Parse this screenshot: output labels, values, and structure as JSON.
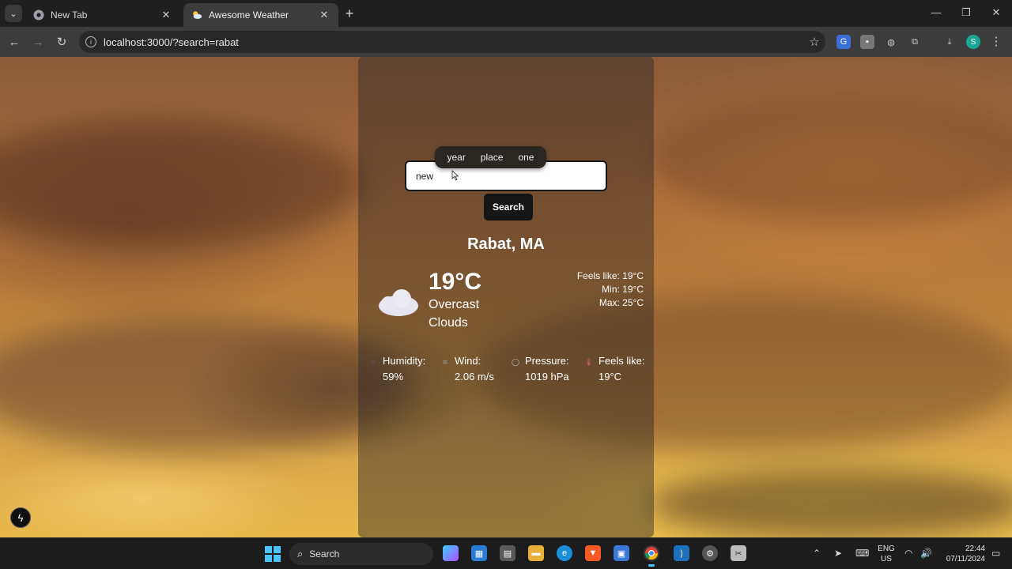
{
  "browser": {
    "tabs": [
      {
        "title": "New Tab",
        "icon": "chrome-icon",
        "active": false
      },
      {
        "title": "Awesome Weather",
        "icon": "weather-cloud-icon",
        "active": true
      }
    ],
    "url": "localhost:3000/?search=rabat"
  },
  "page": {
    "search": {
      "value": "new",
      "button_label": "Search"
    },
    "suggestions": [
      "year",
      "place",
      "one"
    ],
    "location": "Rabat, MA",
    "current": {
      "temperature": "19°C",
      "description": "Overcast Clouds",
      "icon": "cloud-icon"
    },
    "side_stats": [
      "Feels like: 19°C",
      "Min: 19°C",
      "Max: 25°C"
    ],
    "metrics": [
      {
        "label": "Humidity:",
        "value": "59%",
        "icon": "droplet-icon"
      },
      {
        "label": "Wind:",
        "value": "2.06 m/s",
        "icon": "wind-icon"
      },
      {
        "label": "Pressure:",
        "value": "1019 hPa",
        "icon": "gauge-icon"
      },
      {
        "label": "Feels like:",
        "value": "19°C",
        "icon": "thermometer-icon"
      }
    ]
  },
  "taskbar": {
    "search_label": "Search",
    "language": [
      "ENG",
      "US"
    ],
    "time": "22:44",
    "date": "07/11/2024"
  },
  "colors": {
    "accent": "#4cc2ff",
    "card_bg": "rgba(45,38,36,0.45)",
    "button_bg": "#151515"
  }
}
